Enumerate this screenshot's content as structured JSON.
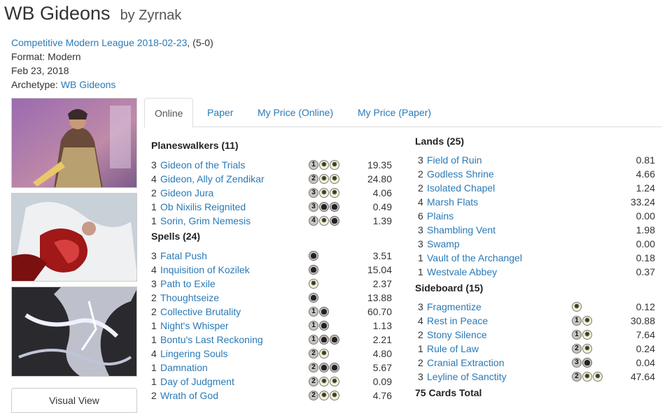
{
  "deck": {
    "name": "WB Gideons",
    "by": "by Zyrnak"
  },
  "meta": {
    "event": "Competitive Modern League 2018-02-23",
    "record": ", (5-0)",
    "format": "Format: Modern",
    "date": "Feb 23, 2018",
    "archetype_label": "Archetype: ",
    "archetype": "WB Gideons"
  },
  "visual_view_label": "Visual View",
  "tabs": [
    "Online",
    "Paper",
    "My Price (Online)",
    "My Price (Paper)"
  ],
  "sections": {
    "planeswalkers": {
      "title": "Planeswalkers (11)",
      "cards": [
        {
          "qty": "3",
          "name": "Gideon of the Trials",
          "mana": [
            "1",
            "W",
            "W"
          ],
          "price": "19.35"
        },
        {
          "qty": "4",
          "name": "Gideon, Ally of Zendikar",
          "mana": [
            "2",
            "W",
            "W"
          ],
          "price": "24.80"
        },
        {
          "qty": "2",
          "name": "Gideon Jura",
          "mana": [
            "3",
            "W",
            "W"
          ],
          "price": "4.06"
        },
        {
          "qty": "1",
          "name": "Ob Nixilis Reignited",
          "mana": [
            "3",
            "B",
            "B"
          ],
          "price": "0.49"
        },
        {
          "qty": "1",
          "name": "Sorin, Grim Nemesis",
          "mana": [
            "4",
            "W",
            "B"
          ],
          "price": "1.39"
        }
      ]
    },
    "spells": {
      "title": "Spells (24)",
      "cards": [
        {
          "qty": "3",
          "name": "Fatal Push",
          "mana": [
            "B"
          ],
          "price": "3.51"
        },
        {
          "qty": "4",
          "name": "Inquisition of Kozilek",
          "mana": [
            "B"
          ],
          "price": "15.04"
        },
        {
          "qty": "3",
          "name": "Path to Exile",
          "mana": [
            "W"
          ],
          "price": "2.37"
        },
        {
          "qty": "2",
          "name": "Thoughtseize",
          "mana": [
            "B"
          ],
          "price": "13.88"
        },
        {
          "qty": "2",
          "name": "Collective Brutality",
          "mana": [
            "1",
            "B"
          ],
          "price": "60.70"
        },
        {
          "qty": "1",
          "name": "Night's Whisper",
          "mana": [
            "1",
            "B"
          ],
          "price": "1.13"
        },
        {
          "qty": "1",
          "name": "Bontu's Last Reckoning",
          "mana": [
            "1",
            "B",
            "B"
          ],
          "price": "2.21"
        },
        {
          "qty": "4",
          "name": "Lingering Souls",
          "mana": [
            "2",
            "W"
          ],
          "price": "4.80"
        },
        {
          "qty": "1",
          "name": "Damnation",
          "mana": [
            "2",
            "B",
            "B"
          ],
          "price": "5.67"
        },
        {
          "qty": "1",
          "name": "Day of Judgment",
          "mana": [
            "2",
            "W",
            "W"
          ],
          "price": "0.09"
        },
        {
          "qty": "2",
          "name": "Wrath of God",
          "mana": [
            "2",
            "W",
            "W"
          ],
          "price": "4.76"
        }
      ]
    },
    "lands": {
      "title": "Lands (25)",
      "cards": [
        {
          "qty": "3",
          "name": "Field of Ruin",
          "mana": [],
          "price": "0.81"
        },
        {
          "qty": "2",
          "name": "Godless Shrine",
          "mana": [],
          "price": "4.66"
        },
        {
          "qty": "2",
          "name": "Isolated Chapel",
          "mana": [],
          "price": "1.24"
        },
        {
          "qty": "4",
          "name": "Marsh Flats",
          "mana": [],
          "price": "33.24"
        },
        {
          "qty": "6",
          "name": "Plains",
          "mana": [],
          "price": "0.00"
        },
        {
          "qty": "3",
          "name": "Shambling Vent",
          "mana": [],
          "price": "1.98"
        },
        {
          "qty": "3",
          "name": "Swamp",
          "mana": [],
          "price": "0.00"
        },
        {
          "qty": "1",
          "name": "Vault of the Archangel",
          "mana": [],
          "price": "0.18"
        },
        {
          "qty": "1",
          "name": "Westvale Abbey",
          "mana": [],
          "price": "0.37"
        }
      ]
    },
    "sideboard": {
      "title": "Sideboard (15)",
      "cards": [
        {
          "qty": "3",
          "name": "Fragmentize",
          "mana": [
            "W"
          ],
          "price": "0.12"
        },
        {
          "qty": "4",
          "name": "Rest in Peace",
          "mana": [
            "1",
            "W"
          ],
          "price": "30.88"
        },
        {
          "qty": "2",
          "name": "Stony Silence",
          "mana": [
            "1",
            "W"
          ],
          "price": "7.64"
        },
        {
          "qty": "1",
          "name": "Rule of Law",
          "mana": [
            "2",
            "W"
          ],
          "price": "0.24"
        },
        {
          "qty": "2",
          "name": "Cranial Extraction",
          "mana": [
            "3",
            "B"
          ],
          "price": "0.04"
        },
        {
          "qty": "3",
          "name": "Leyline of Sanctity",
          "mana": [
            "2",
            "W",
            "W"
          ],
          "price": "47.64"
        }
      ]
    }
  },
  "total": "75 Cards Total",
  "colors": {
    "link": "#2a7ab7",
    "text": "#333333",
    "border": "#dddddd"
  }
}
